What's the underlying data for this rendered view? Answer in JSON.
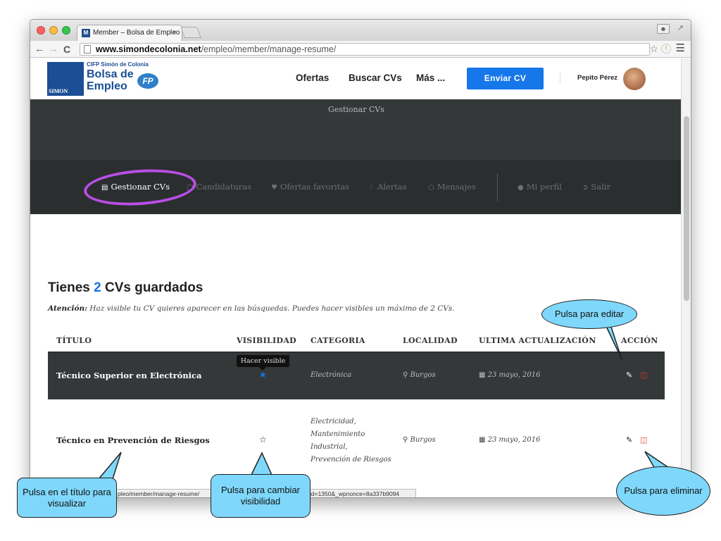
{
  "browser": {
    "tab_title": "Member – Bolsa de Empleo",
    "tab_close": "×",
    "url_host": "www.simondecolonia.net",
    "url_path": "/empleo/member/manage-resume/",
    "status_left": "pleo/member/manage-resume/",
    "status_right": "id=1350&_wpnonce=8a337b9094"
  },
  "site": {
    "logo_sub": "CIFP Simón de Colonia",
    "logo_line1": "Bolsa de",
    "logo_line2": "Empleo",
    "logo_mark_text": "SIMON",
    "logo_badge": "FP",
    "nav": [
      "Ofertas",
      "Buscar CVs",
      "Más ..."
    ],
    "enviar_cv": "Enviar CV",
    "user_name": "Pepito Pérez"
  },
  "banner": {
    "title": "Gestionar CVs"
  },
  "dashboard_nav": [
    {
      "label": "Gestionar CVs",
      "active": true
    },
    {
      "label": "Candidaturas"
    },
    {
      "label": "Ofertas favoritas"
    },
    {
      "label": "Alertas"
    },
    {
      "label": "Mensajes"
    },
    {
      "label": "Mi perfil"
    },
    {
      "label": "Salir"
    }
  ],
  "content": {
    "title_prefix": "Tienes",
    "count": "2",
    "title_suffix": "CVs guardados",
    "notice_label": "Atención:",
    "notice_text": "Haz visible tu CV quieres aparecer en las búsquedas. Puedes hacer visibles un máximo de 2 CVs."
  },
  "table": {
    "headers": [
      "TÍTULO",
      "VISIBILIDAD",
      "CATEGORIA",
      "LOCALIDAD",
      "ULTIMA ACTUALIZACIÓN",
      "ACCIÓN"
    ],
    "tooltip": "Hacer visible",
    "rows": [
      {
        "title": "Técnico Superior en Electrónica",
        "category": [
          "Electrónica"
        ],
        "location": "Burgos",
        "updated": "23 mayo, 2016",
        "visible": true
      },
      {
        "title": "Técnico en Prevención de Riesgos",
        "category": [
          "Electricidad,",
          "Mantenimiento",
          "Industrial,",
          "Prevención de Riesgos"
        ],
        "location": "Burgos",
        "updated": "23 mayo, 2016",
        "visible": false
      }
    ]
  },
  "callouts": {
    "editar": "Pulsa para editar",
    "titulo": "Pulsa en el título para visualizar",
    "visibilidad": "Pulsa para cambiar visibilidad",
    "eliminar": "Pulsa para eliminar"
  },
  "colors": {
    "accent_blue": "#1677ea",
    "dark_banner": "#353839",
    "dark_nav": "#2b2e2f",
    "callout_fill": "#7fd8fb",
    "highlight_ellipse": "#b94ee6",
    "delete_red": "#e0383a"
  },
  "icons": [
    "document-icon",
    "folder-icon",
    "heart-icon",
    "bell-icon",
    "chat-icon",
    "user-icon",
    "sign-out-icon",
    "star-icon",
    "pencil-icon",
    "trash-icon",
    "map-marker-icon",
    "calendar-icon"
  ]
}
